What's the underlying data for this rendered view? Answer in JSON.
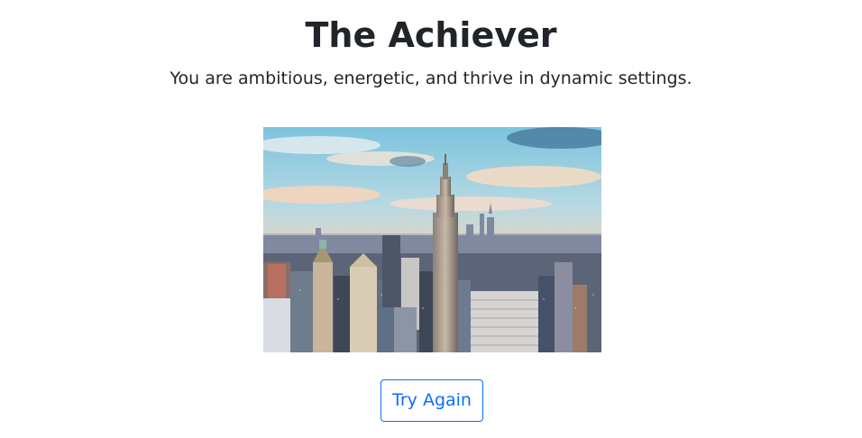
{
  "result": {
    "title": "The Achiever",
    "description": "You are ambitious, energetic, and thrive in dynamic settings.",
    "image_subject": "city-skyline-photo"
  },
  "actions": {
    "try_again_label": "Try Again"
  },
  "colors": {
    "text": "#212529",
    "accent": "#0d6efd",
    "background": "#ffffff"
  }
}
